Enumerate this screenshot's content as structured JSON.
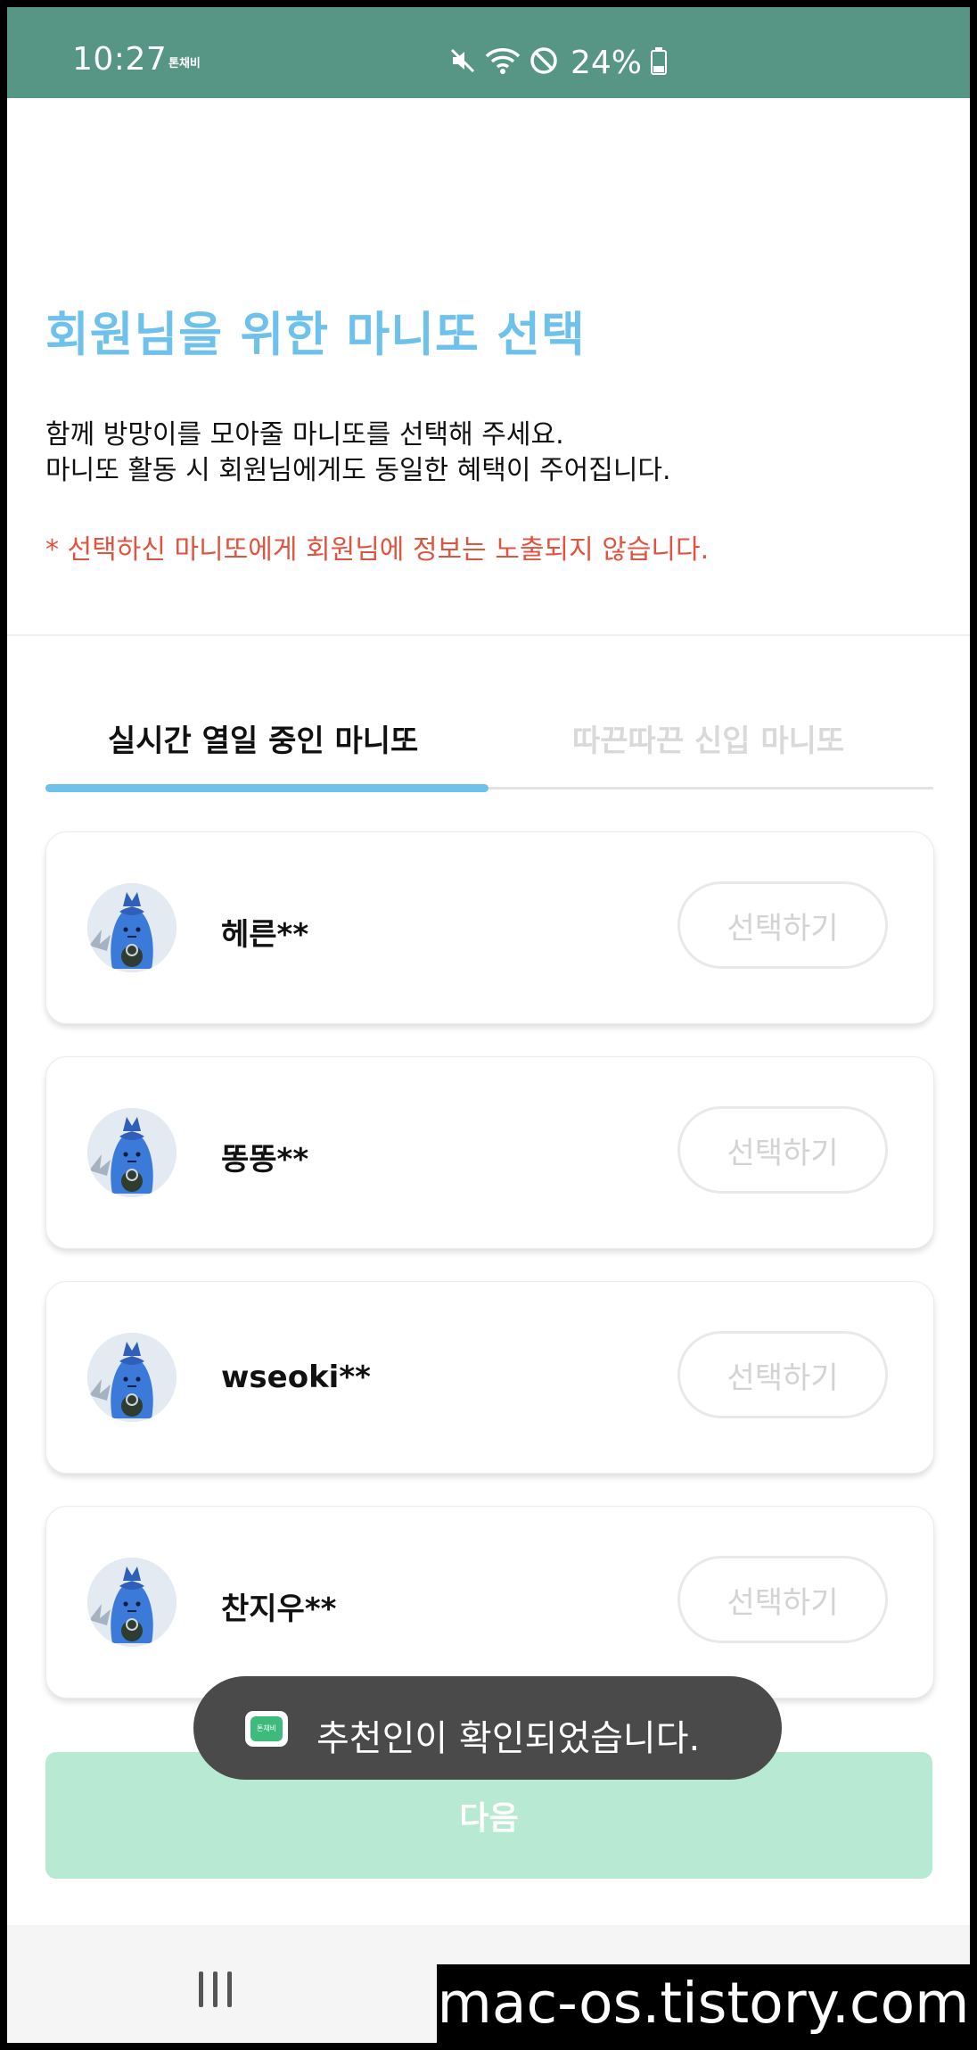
{
  "status_bar": {
    "time": "10:27",
    "carrier_badge": "톤채비",
    "battery": "24%",
    "icons": [
      "mute-icon",
      "wifi-icon",
      "do-not-disturb-icon",
      "battery-icon"
    ],
    "background": "#579584"
  },
  "header": {
    "title": "회원님을 위한 마니또 선택",
    "description_line1": "함께 방망이를 모아줄 마니또를 선택해 주세요.",
    "description_line2": "마니또 활동 시 회원님에게도 동일한 혜택이 주어집니다.",
    "notice": "* 선택하신 마니또에게 회원님에 정보는 노출되지 않습니다."
  },
  "tabs": [
    {
      "label": "실시간 열일 중인 마니또",
      "active": true
    },
    {
      "label": "따끈따끈 신입 마니또",
      "active": false
    }
  ],
  "manitos": [
    {
      "name": "헤른**",
      "button_label": "선택하기"
    },
    {
      "name": "똥똥**",
      "button_label": "선택하기"
    },
    {
      "name": "wseoki**",
      "button_label": "선택하기"
    },
    {
      "name": "찬지우**",
      "button_label": "선택하기"
    }
  ],
  "next_button": {
    "label": "다음"
  },
  "toast": {
    "icon_text": "톤채비",
    "message": "추천인이 확인되었습니다."
  },
  "watermark": "mac-os.tistory.com",
  "colors": {
    "accent": "#6ec1ea",
    "notice": "#e0533f",
    "next_button_bg": "#b8ead3",
    "toast_bg": "#4a4a4a"
  }
}
